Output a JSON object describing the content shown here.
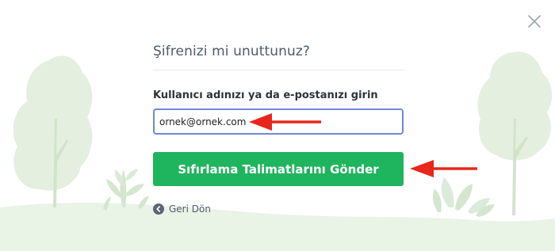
{
  "dialog": {
    "title": "Şifrenizi mi unuttunuz?",
    "close_icon": "close-icon"
  },
  "form": {
    "label": "Kullanıcı adınızı ya da e-postanızı girin",
    "email_value": "ornek@ornek.com",
    "submit_label": "Sıfırlama Talimatlarını Gönder",
    "back_label": "Geri Dön",
    "back_icon": "chevron-left-circle-icon"
  },
  "colors": {
    "primary_button": "#1fb45e",
    "input_focus_border": "#6f88d8",
    "annotation_arrow": "#e8261b",
    "background_art": "#e9f3e6"
  }
}
